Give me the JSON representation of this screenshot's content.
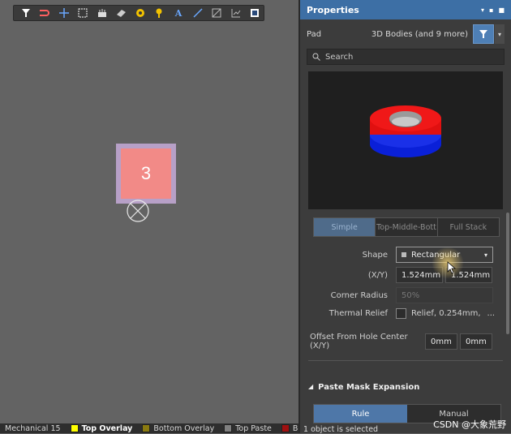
{
  "toolbar": {
    "icons": [
      "filter-icon",
      "route-icon",
      "cross-icon",
      "select-rect-icon",
      "component-icon",
      "eraser-icon",
      "via-icon",
      "pin-icon",
      "text-icon",
      "line-icon",
      "rectangle-icon",
      "chart-icon",
      "monitor-icon"
    ],
    "text_tool_label": "A"
  },
  "pad": {
    "designator": "3",
    "fill_color": "#f28a87",
    "outline_color": "#b7a0c7"
  },
  "layers": [
    {
      "name": "Mechanical 15",
      "color": "#b0b0b0",
      "active": false
    },
    {
      "name": "Top Overlay",
      "color": "#ffff00",
      "active": true
    },
    {
      "name": "Bottom Overlay",
      "color": "#8a7a10",
      "active": false
    },
    {
      "name": "Top Paste",
      "color": "#808080",
      "active": false
    },
    {
      "name": "Botto",
      "color": "#a01010",
      "active": false
    }
  ],
  "panel": {
    "title": "Properties",
    "object_type": "Pad",
    "selection_filter": "3D Bodies (and 9 more)",
    "search_placeholder": "Search",
    "mode_tabs": [
      "Simple",
      "Top-Middle-Bott",
      "Full Stack"
    ],
    "active_mode": "Simple",
    "shape_label": "Shape",
    "shape_value": "Rectangular",
    "xy_label": "(X/Y)",
    "x_value": "1.524mm",
    "y_value": "1.524mm",
    "corner_radius_label": "Corner Radius",
    "corner_radius_value": "50%",
    "thermal_relief_label": "Thermal Relief",
    "thermal_relief_value": "Relief, 0.254mm,",
    "thermal_relief_more": "...",
    "offset_label": "Offset From Hole Center (X/Y)",
    "offset_x": "0mm",
    "offset_y": "0mm",
    "paste_section": "Paste Mask Expansion",
    "rule_tabs": [
      "Rule",
      "Manual"
    ],
    "active_rule": "Rule",
    "status": "1 object is selected"
  },
  "watermark": "CSDN @大象荒野",
  "accent_color": "#3d6fa5"
}
